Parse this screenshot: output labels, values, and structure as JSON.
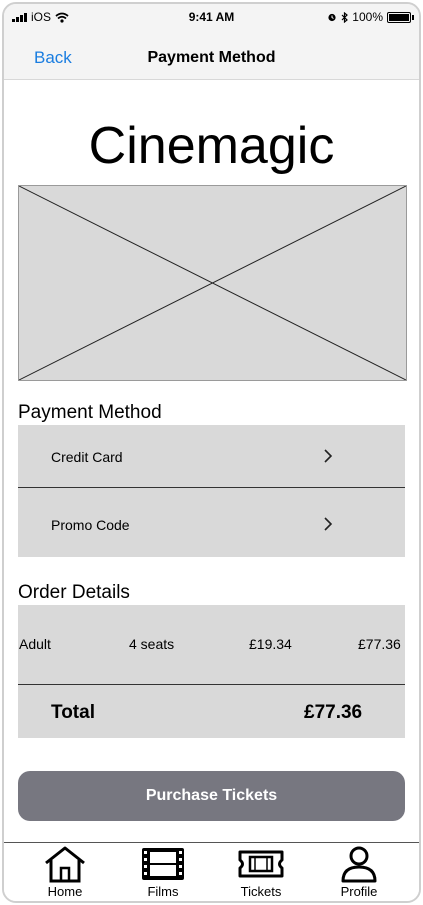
{
  "status_bar": {
    "carrier": "iOS",
    "time": "9:41 AM",
    "battery": "100%"
  },
  "nav": {
    "back_label": "Back",
    "title": "Payment Method"
  },
  "brand": "Cinemagic",
  "payment_section": {
    "title": "Payment Method",
    "options": [
      {
        "label": "Credit Card"
      },
      {
        "label": "Promo Code"
      }
    ]
  },
  "order_section": {
    "title": "Order Details",
    "line": {
      "ticket_type": "Adult",
      "seats": "4 seats",
      "unit_price": "£19.34",
      "subtotal": "£77.36"
    },
    "total_label": "Total",
    "total_value": "£77.36"
  },
  "purchase_button": "Purchase Tickets",
  "tabs": [
    {
      "label": "Home",
      "icon": "home-icon"
    },
    {
      "label": "Films",
      "icon": "film-icon"
    },
    {
      "label": "Tickets",
      "icon": "ticket-icon"
    },
    {
      "label": "Profile",
      "icon": "profile-icon"
    }
  ]
}
